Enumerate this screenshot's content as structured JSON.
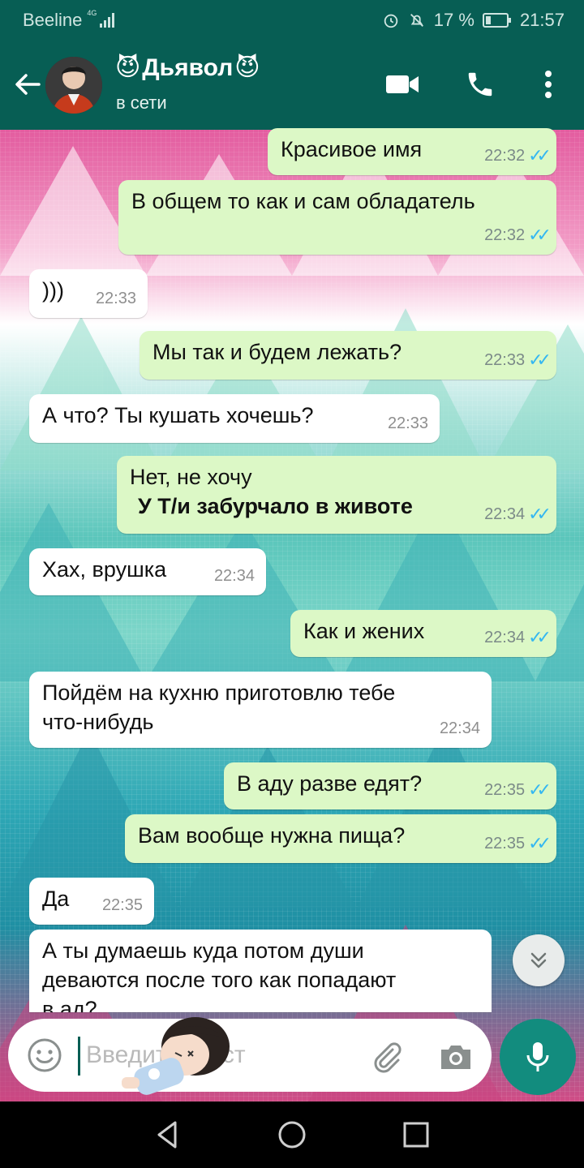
{
  "status_bar": {
    "carrier": "Beeline",
    "network": "4G",
    "battery": "17 %",
    "time": "21:57"
  },
  "header": {
    "contact_emoji": "😈",
    "contact_name": "Дьявол",
    "status": "в сети",
    "icons": [
      "back-arrow-icon",
      "video-call-icon",
      "phone-icon",
      "more-vertical-icon"
    ]
  },
  "messages": [
    {
      "dir": "out",
      "text": "Красивое имя",
      "time": "22:32",
      "read": true
    },
    {
      "dir": "out",
      "text": "В общем то как и сам обладатель",
      "time": "22:32",
      "read": true
    },
    {
      "dir": "in",
      "text": ")))",
      "time": "22:33"
    },
    {
      "dir": "out",
      "text": "Мы так и будем лежать?",
      "time": "22:33",
      "read": true
    },
    {
      "dir": "in",
      "text": "А что? Ты кушать хочешь?",
      "time": "22:33"
    },
    {
      "dir": "out",
      "text": "Нет, не хочу",
      "text2": "У Т/и забурчало в животе",
      "time": "22:34",
      "read": true
    },
    {
      "dir": "in",
      "text": "Хах, врушка",
      "time": "22:34"
    },
    {
      "dir": "out",
      "text": "Как и жених",
      "time": "22:34",
      "read": true
    },
    {
      "dir": "in",
      "text": "Пойдём на кухню приготовлю тебе\nчто-нибудь",
      "time": "22:34"
    },
    {
      "dir": "out",
      "text": "В аду разве едят?",
      "time": "22:35",
      "read": true
    },
    {
      "dir": "out",
      "text": "Вам вообще нужна пища?",
      "time": "22:35",
      "read": true
    },
    {
      "dir": "in",
      "text": "Да",
      "time": "22:35"
    },
    {
      "dir": "in",
      "text": "А ты думаешь куда потом души\nдеваются после того как попадают\nв ад?",
      "time": ""
    }
  ],
  "composer": {
    "placeholder": "Введите текст"
  },
  "colors": {
    "header": "#075e54",
    "outgoing_bubble": "#dcf8c6",
    "incoming_bubble": "#ffffff",
    "read_ticks": "#34b7f1",
    "mic_button": "#128c7e"
  }
}
